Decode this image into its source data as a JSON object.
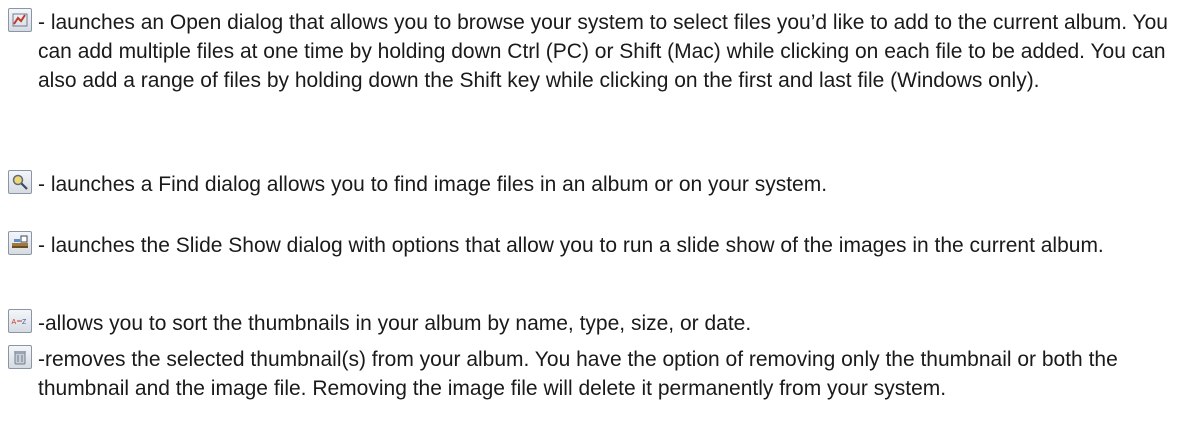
{
  "items": [
    {
      "icon": "add-files-icon",
      "text": "- launches an Open dialog that allows you to browse your system to select files you’d like to add to the current album. You can add multiple files at one time by holding down Ctrl (PC) or Shift (Mac) while clicking on each file to be added. You can also add a range of files by holding down the Shift key while clicking on the first and last file (Windows only)."
    },
    {
      "icon": "find-icon",
      "text": "- launches a Find dialog allows you to find image files in an album or on your system."
    },
    {
      "icon": "slide-show-icon",
      "text": "- launches the Slide Show dialog with options that allow you to run a slide show of the images in the current album."
    },
    {
      "icon": "sort-icon",
      "text": "-allows you to sort the thumbnails in your album by name, type, size, or date."
    },
    {
      "icon": "trash-icon",
      "text": "-removes the selected thumbnail(s) from your album. You have the option of removing only the thumbnail or both the thumbnail and the image file. Removing the image file will delete it permanently from your system."
    }
  ]
}
